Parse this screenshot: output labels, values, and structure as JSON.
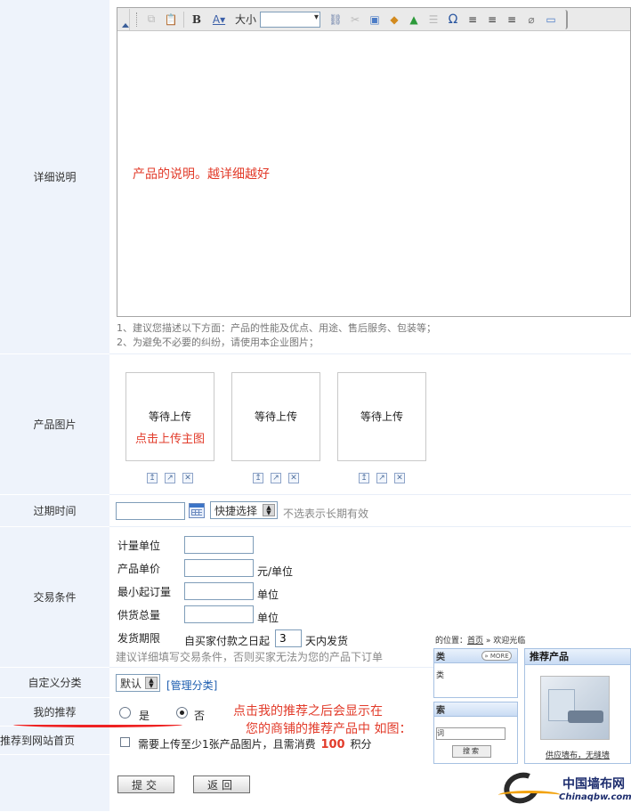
{
  "rows": {
    "detail": "详细说明",
    "images": "产品图片",
    "expire": "过期时间",
    "trade": "交易条件",
    "category": "自定义分类",
    "recommend": "我的推荐",
    "homepage": "推荐到网站首页"
  },
  "editor": {
    "font_size_label": "大小",
    "content_note": "产品的说明。越详细越好",
    "hint1": "1、建议您描述以下方面：产品的性能及优点、用途、售后服务、包装等；",
    "hint2": "2、为避免不必要的纠纷，请使用本企业图片；"
  },
  "images": {
    "waiting": "等待上传",
    "upload_main": "点击上传主图",
    "icons": [
      "↥",
      "↗",
      "✕"
    ]
  },
  "expire": {
    "quick_select": "快捷选择",
    "note": "不选表示长期有效"
  },
  "trade": {
    "unit_label": "计量单位",
    "price_label": "产品单价",
    "price_suffix": "元/单位",
    "min_order_label": "最小起订量",
    "min_order_suffix": "单位",
    "supply_label": "供货总量",
    "supply_suffix": "单位",
    "delivery_label": "发货期限",
    "delivery_prefix": "自买家付款之日起",
    "delivery_value": "3",
    "delivery_suffix": "天内发货",
    "note": "建议详细填写交易条件，否则买家无法为您的产品下订单"
  },
  "category": {
    "selected": "默认",
    "manage_link": "[管理分类]"
  },
  "recommend": {
    "yes": "是",
    "no": "否",
    "selected": "no",
    "annotation_line1": "点击我的推荐之后会显示在",
    "annotation_line2": "您的商铺的推荐产品中 如图："
  },
  "homepage": {
    "prefix": "需要上传至少1张产品图片，且需消费",
    "points": "100",
    "suffix": "积分"
  },
  "buttons": {
    "submit": "提交",
    "back": "返回"
  },
  "preview": {
    "crumb_prefix": "的位置：",
    "crumb_home": "首页",
    "crumb_rest": "» 欢迎光临",
    "more": "» MORE",
    "side_title_tail": "类",
    "side_item": "类",
    "search_title_tail": "索",
    "search_field": "词",
    "search_button": "搜索",
    "recommend_title": "推荐产品",
    "product_caption": "供应墙布，无缝墙"
  },
  "logo": {
    "cn": "中国墙布网",
    "en": "Chinaqbw.com"
  },
  "colors": {
    "label_bg": "#eef3fb",
    "annotation": "#e23b2a",
    "link": "#1f5fb0"
  }
}
